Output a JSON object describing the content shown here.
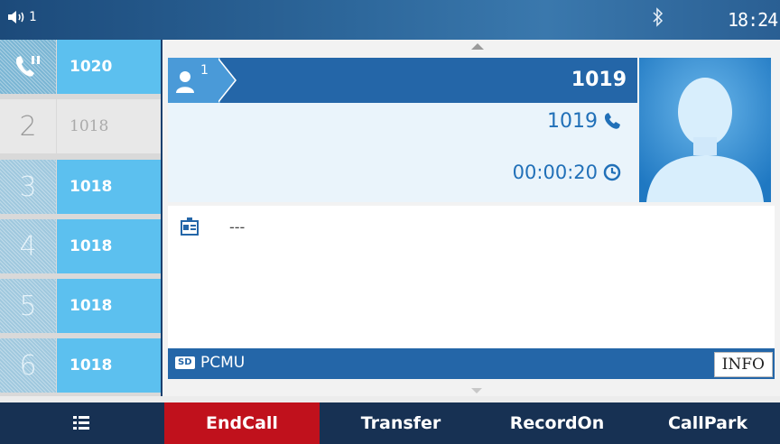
{
  "status_bar": {
    "volume_icon": "speaker-icon",
    "volume_label": "1",
    "bluetooth_icon": "bluetooth-icon",
    "time": "18:24"
  },
  "lines": [
    {
      "label": "",
      "icon": "call-hold-icon",
      "extension": "1020",
      "state": "active"
    },
    {
      "label": "2",
      "extension": "1018",
      "state": "idle"
    },
    {
      "label": "3",
      "extension": "1018",
      "state": "normal"
    },
    {
      "label": "4",
      "extension": "1018",
      "state": "normal"
    },
    {
      "label": "5",
      "extension": "1018",
      "state": "normal"
    },
    {
      "label": "6",
      "extension": "1018",
      "state": "normal"
    }
  ],
  "call": {
    "line_index": "1",
    "name": "1019",
    "number": "1019",
    "duration": "00:00:20"
  },
  "info": {
    "text": "---"
  },
  "codec_bar": {
    "hd_badge": "SD",
    "codec": "PCMU",
    "info_button": "INFO"
  },
  "softkeys": {
    "menu_icon": "menu-list-icon",
    "end_call": "EndCall",
    "transfer": "Transfer",
    "record_on": "RecordOn",
    "call_park": "CallPark"
  },
  "colors": {
    "header_blue": "#2466a8",
    "line_blue": "#5cc0ef",
    "end_call_red": "#c0111c",
    "softkey_bg": "#173153"
  }
}
